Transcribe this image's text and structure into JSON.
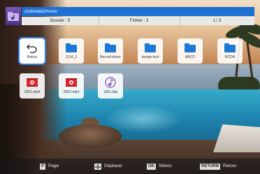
{
  "header": {
    "path": "/usb/sda1/music",
    "folders_label": "Dossier : 5",
    "files_label": "Fichier : 3",
    "page_label": "1 / 3"
  },
  "grid": {
    "items": [
      {
        "label": "Retour",
        "icon": "back-arrow-icon",
        "selected": true
      },
      {
        "label": "1114_2",
        "icon": "folder-icon"
      },
      {
        "label": "Record driver",
        "icon": "folder-icon"
      },
      {
        "label": "design test",
        "icon": "folder-icon"
      },
      {
        "label": "ABCD",
        "icon": "folder-icon"
      },
      {
        "label": "BCDA",
        "icon": "folder-icon"
      },
      {
        "label": "0001.mp4",
        "icon": "video-file-icon"
      },
      {
        "label": "0002.mp4",
        "icon": "video-file-icon"
      },
      {
        "label": "1281.kbp",
        "icon": "music-note-icon"
      }
    ]
  },
  "footer": {
    "page": {
      "key": "P",
      "label": "Page"
    },
    "move": {
      "key": "dpad-icon",
      "label": "Déplacer"
    },
    "select": {
      "key": "OK",
      "label": "Sélect."
    },
    "back": {
      "key": "RETURN",
      "label": "Retour"
    }
  },
  "colors": {
    "accent": "#1d6fd1",
    "folder": "#1c79d8",
    "video": "#e0252f",
    "music": "#7b52b3"
  }
}
